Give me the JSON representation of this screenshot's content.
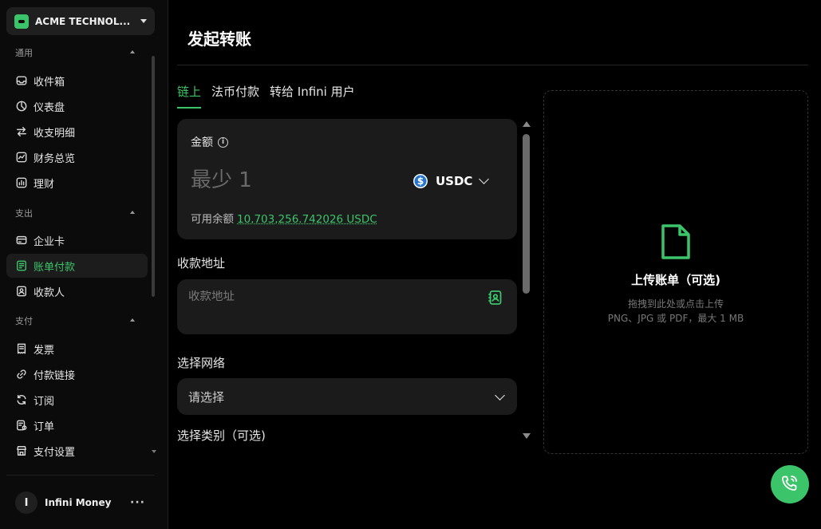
{
  "org": {
    "name": "ACME TECHNOL..."
  },
  "sidebar": {
    "sections": [
      {
        "title": "通用",
        "items": [
          {
            "label": "收件箱",
            "icon": "inbox-icon"
          },
          {
            "label": "仪表盘",
            "icon": "dashboard-icon"
          },
          {
            "label": "收支明细",
            "icon": "transfer-arrows-icon"
          },
          {
            "label": "财务总览",
            "icon": "chart-icon"
          },
          {
            "label": "理财",
            "icon": "bar-chart-icon"
          }
        ]
      },
      {
        "title": "支出",
        "items": [
          {
            "label": "企业卡",
            "icon": "card-icon"
          },
          {
            "label": "账单付款",
            "icon": "bill-icon",
            "active": true
          },
          {
            "label": "收款人",
            "icon": "contact-icon"
          }
        ]
      },
      {
        "title": "支付",
        "items": [
          {
            "label": "发票",
            "icon": "invoice-icon"
          },
          {
            "label": "付款链接",
            "icon": "link-icon"
          },
          {
            "label": "订阅",
            "icon": "refresh-icon"
          },
          {
            "label": "订单",
            "icon": "order-icon"
          },
          {
            "label": "支付设置",
            "icon": "store-icon"
          }
        ]
      }
    ],
    "user": {
      "initial": "I",
      "name": "Infini Money",
      "more": "···"
    }
  },
  "main": {
    "title": "发起转账",
    "tabs": [
      {
        "label": "链上",
        "active": true
      },
      {
        "label": "法币付款"
      },
      {
        "label": "转给 Infini 用户"
      }
    ],
    "amount": {
      "label": "金额",
      "placeholder": "最少 1",
      "token": "USDC",
      "balance_label": "可用余额",
      "balance_value": "10,703,256.742026 USDC"
    },
    "address": {
      "label": "收款地址",
      "placeholder": "收款地址"
    },
    "network": {
      "label": "选择网络",
      "placeholder": "请选择"
    },
    "category": {
      "label": "选择类别（可选)"
    },
    "upload": {
      "title": "上传账单（可选)",
      "hint_line1": "拖拽到此处或点击上传",
      "hint_line2": "PNG、JPG 或 PDF，最大 1 MB"
    }
  },
  "colors": {
    "accent": "#3cc46a",
    "background": "#000000",
    "card": "#1b1b1b"
  }
}
